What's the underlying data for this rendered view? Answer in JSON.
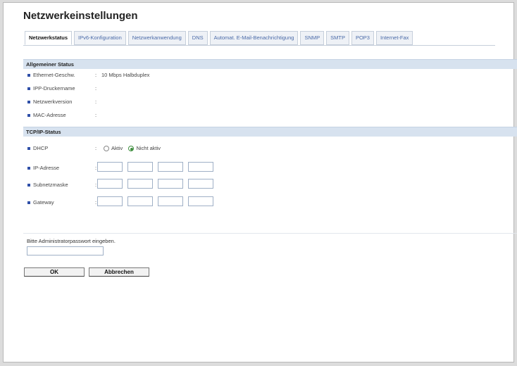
{
  "page": {
    "title": "Netzwerkeinstellungen"
  },
  "tabs": [
    {
      "label": "Netzwerkstatus",
      "active": true
    },
    {
      "label": "IPv6-Konfiguration"
    },
    {
      "label": "Netzwerkanwendung"
    },
    {
      "label": "DNS"
    },
    {
      "label": "Automat. E-Mail-Benachrichtigung"
    },
    {
      "label": "SNMP"
    },
    {
      "label": "SMTP"
    },
    {
      "label": "POP3"
    },
    {
      "label": "Internet-Fax"
    }
  ],
  "general_status": {
    "heading": "Allgemeiner Status",
    "rows": [
      {
        "label": "Ethernet-Geschw.",
        "value": "10 Mbps Halbduplex"
      },
      {
        "label": "IPP-Druckername",
        "value": ""
      },
      {
        "label": "Netzwerkversion",
        "value": ""
      },
      {
        "label": "MAC-Adresse",
        "value": ""
      }
    ]
  },
  "tcpip_status": {
    "heading": "TCP/IP-Status",
    "dhcp": {
      "label": "DHCP",
      "option_active": "Aktiv",
      "option_inactive": "Nicht aktiv",
      "selected": "Nicht aktiv"
    },
    "ip_label": "IP-Adresse",
    "subnet_label": "Subnetzmaske",
    "gateway_label": "Gateway"
  },
  "admin": {
    "prompt": "Bitte Administratorpasswort eingeben.",
    "password_value": ""
  },
  "buttons": {
    "ok": "OK",
    "cancel": "Abbrechen"
  },
  "separator": ":",
  "colors": {
    "tab_text": "#4a6aa8",
    "section_bg": "#d7e2ef",
    "bullet": "#2f4fa8"
  }
}
